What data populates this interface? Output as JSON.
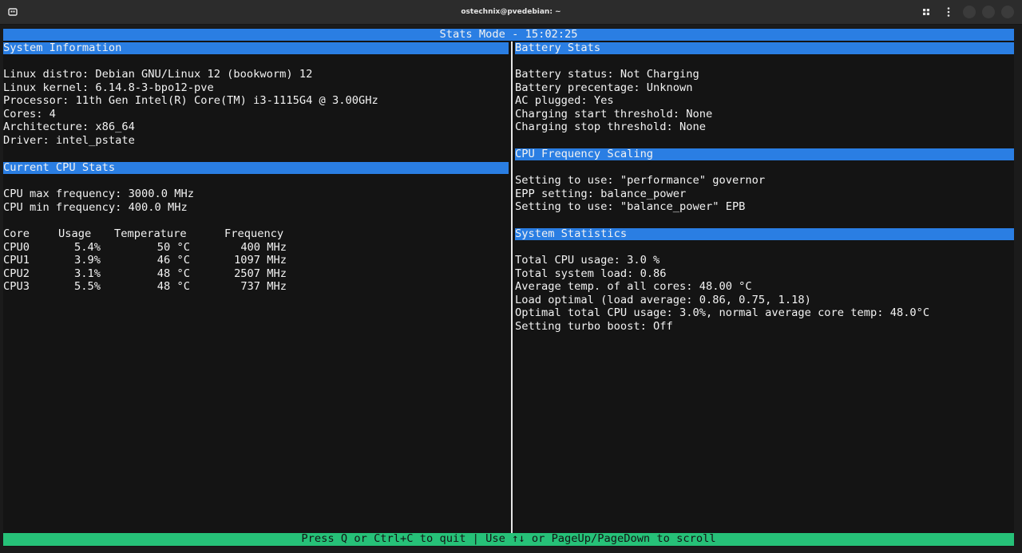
{
  "window": {
    "title": "ostechnix@pvedebian: ~"
  },
  "header": {
    "text": "Stats Mode - 15:02:25"
  },
  "left": {
    "system_info": {
      "title": "System Information",
      "lines": [
        "Linux distro: Debian GNU/Linux 12 (bookworm) 12",
        "Linux kernel: 6.14.8-3-bpo12-pve",
        "Processor: 11th Gen Intel(R) Core(TM) i3-1115G4 @ 3.00GHz",
        "Cores: 4",
        "Architecture: x86_64",
        "Driver: intel_pstate"
      ]
    },
    "cpu_stats": {
      "title": "Current CPU Stats",
      "max_freq": "CPU max frequency: 3000.0 MHz",
      "min_freq": "CPU min frequency: 400.0 MHz",
      "headers": [
        "Core",
        "Usage",
        "Temperature",
        "Frequency"
      ],
      "rows": [
        [
          "CPU0",
          "5.4%",
          "50 °C",
          "400 MHz"
        ],
        [
          "CPU1",
          "3.9%",
          "46 °C",
          "1097 MHz"
        ],
        [
          "CPU2",
          "3.1%",
          "48 °C",
          "2507 MHz"
        ],
        [
          "CPU3",
          "5.5%",
          "48 °C",
          "737 MHz"
        ]
      ]
    }
  },
  "right": {
    "battery": {
      "title": "Battery Stats",
      "lines": [
        "Battery status: Not Charging",
        "Battery precentage: Unknown",
        "AC plugged: Yes",
        "Charging start threshold: None",
        "Charging stop threshold: None"
      ]
    },
    "scaling": {
      "title": "CPU Frequency Scaling",
      "lines": [
        "Setting to use: \"performance\" governor",
        "EPP setting: balance_power",
        "Setting to use: \"balance_power\" EPB"
      ]
    },
    "system_stats": {
      "title": "System Statistics",
      "lines": [
        "Total CPU usage: 3.0 %",
        "Total system load: 0.86",
        "Average temp. of all cores: 48.00 °C",
        "Load optimal (load average: 0.86, 0.75, 1.18)",
        "Optimal total CPU usage: 3.0%, normal average core temp: 48.0°C",
        "Setting turbo boost: Off"
      ]
    }
  },
  "footer": {
    "text": "Press Q or Ctrl+C to quit | Use ↑↓ or PageUp/PageDown to scroll"
  },
  "colors": {
    "header_bar": "#2a7ee3",
    "footer_bar": "#26c178",
    "terminal_bg": "#141414",
    "titlebar_bg": "#2c2c2c"
  },
  "icons": [
    "new-tab-icon",
    "split-icon",
    "menu-icon"
  ]
}
